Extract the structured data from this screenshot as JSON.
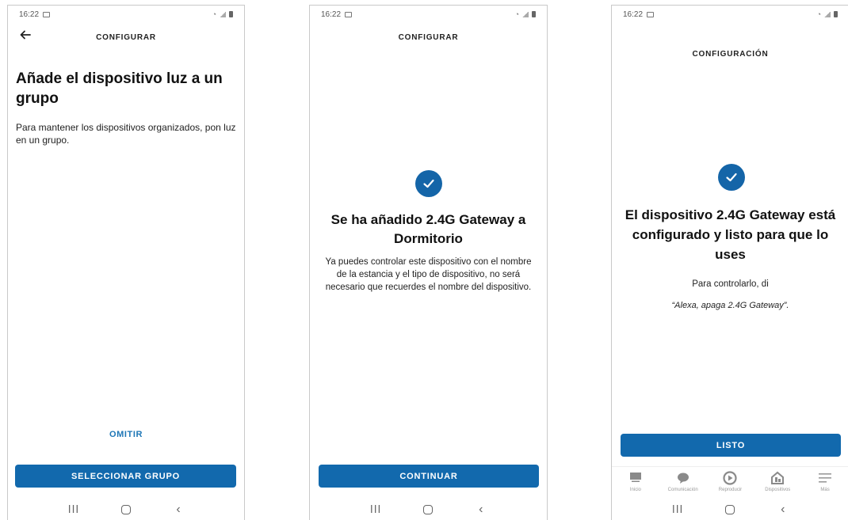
{
  "screens": [
    {
      "status_time": "16:22",
      "header": "CONFIGURAR",
      "title": "Añade el dispositivo luz a un grupo",
      "body": "Para mantener los dispositivos organizados, pon luz en un grupo.",
      "skip_link": "OMITIR",
      "primary_button": "SELECCIONAR GRUPO"
    },
    {
      "status_time": "16:22",
      "header": "CONFIGURAR",
      "title": "Se ha añadido 2.4G Gateway a Dormitorio",
      "body": "Ya puedes controlar este dispositivo con el nombre de la estancia y el tipo de dispositivo, no será necesario que recuerdes el nombre del dispositivo.",
      "primary_button": "CONTINUAR"
    },
    {
      "status_time": "16:22",
      "header": "CONFIGURACIÓN",
      "title": "El dispositivo 2.4G Gateway está configurado y listo para que lo uses",
      "body": "Para controlarlo, di",
      "quote": "“Alexa, apaga 2.4G Gateway”.",
      "primary_button": "LISTO",
      "tabs": [
        {
          "label": "Inicio",
          "icon": "home-icon"
        },
        {
          "label": "Comunicación",
          "icon": "chat-bubble-icon"
        },
        {
          "label": "Reproducir",
          "icon": "play-icon"
        },
        {
          "label": "Dispositivos",
          "icon": "devices-icon"
        },
        {
          "label": "Más",
          "icon": "menu-icon"
        }
      ]
    }
  ],
  "icons": {
    "back": "arrow-left-icon",
    "check": "checkmark-icon",
    "nav_recents": "recent-apps-icon",
    "nav_home": "home-button-icon",
    "nav_back": "back-chevron-icon"
  },
  "colors": {
    "accent": "#1269ad",
    "link": "#1d76b6",
    "check_circle": "#1465a8",
    "tab_inactive": "#9a9a9a"
  }
}
